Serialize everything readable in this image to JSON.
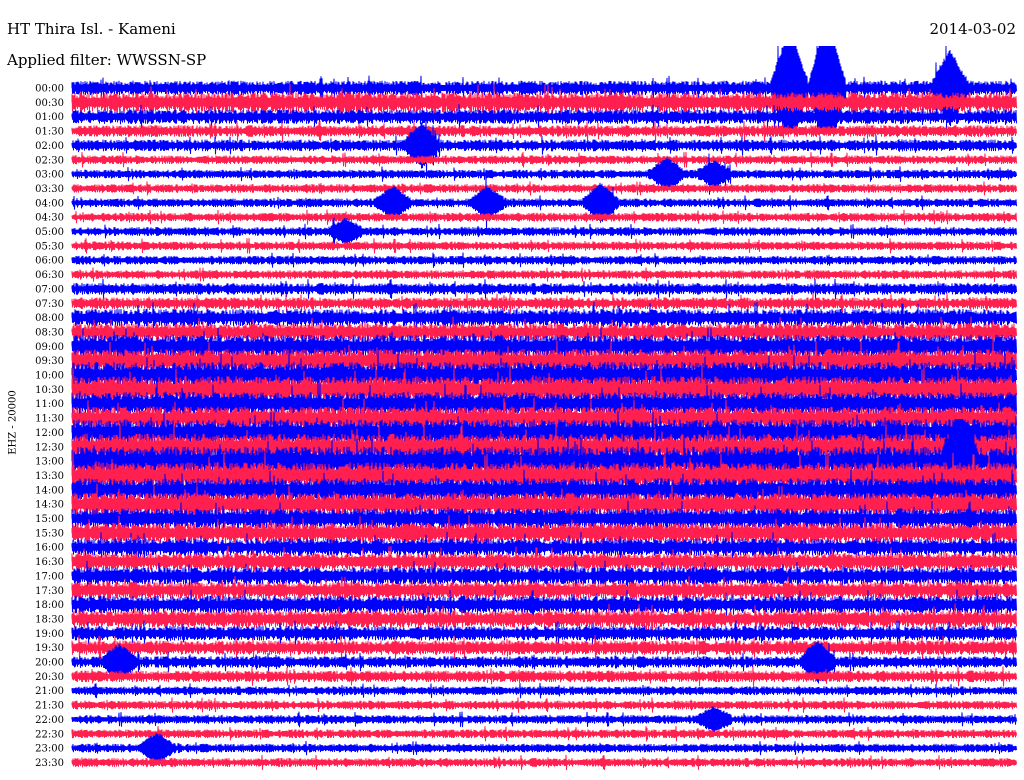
{
  "header": {
    "station": "HT Thira Isl. - Kameni",
    "filter": "Applied filter: WWSSN-SP",
    "date": "2014-03-02"
  },
  "channel_label": "EHZ - 20000",
  "colors": {
    "trace_a": "#0000ff",
    "trace_b": "#ff2050",
    "background": "#ffffff"
  },
  "chart_data": {
    "type": "line",
    "title": "HT Thira Isl. - Kameni",
    "subtitle": "Applied filter: WWSSN-SP",
    "ylabel": "EHZ - 20000",
    "grid": false,
    "row_labels": [
      "00:00",
      "00:30",
      "01:00",
      "01:30",
      "02:00",
      "02:30",
      "03:00",
      "03:30",
      "04:00",
      "04:30",
      "05:00",
      "05:30",
      "06:00",
      "06:30",
      "07:00",
      "07:30",
      "08:00",
      "08:30",
      "09:00",
      "09:30",
      "10:00",
      "10:30",
      "11:00",
      "11:30",
      "12:00",
      "12:30",
      "13:00",
      "13:30",
      "14:00",
      "14:30",
      "15:00",
      "15:30",
      "16:00",
      "16:30",
      "17:00",
      "17:30",
      "18:00",
      "18:30",
      "19:00",
      "19:30",
      "20:00",
      "20:30",
      "21:00",
      "21:30",
      "22:00",
      "22:30",
      "23:00",
      "23:30"
    ],
    "row_colors": [
      "blue",
      "red"
    ],
    "noise_level": [
      5,
      7,
      5,
      4,
      4,
      3,
      3,
      3,
      3,
      3,
      3,
      3,
      3,
      3,
      4,
      4,
      6,
      6,
      8,
      8,
      9,
      9,
      8,
      8,
      9,
      9,
      10,
      9,
      8,
      8,
      7,
      7,
      6,
      6,
      6,
      6,
      6,
      6,
      5,
      5,
      4,
      4,
      3,
      3,
      3,
      3,
      3,
      3
    ],
    "events": [
      {
        "row": 0,
        "x": [
          0.76,
          0.8,
          0.93
        ],
        "amp": [
          5,
          6,
          3
        ]
      },
      {
        "row": 4,
        "x": [
          0.37
        ],
        "amp": [
          2
        ]
      },
      {
        "row": 6,
        "x": [
          0.63,
          0.68
        ],
        "amp": [
          2,
          1.5
        ]
      },
      {
        "row": 8,
        "x": [
          0.34,
          0.44,
          0.56
        ],
        "amp": [
          2,
          2,
          2.5
        ]
      },
      {
        "row": 10,
        "x": [
          0.29
        ],
        "amp": [
          1.5
        ]
      },
      {
        "row": 26,
        "x": [
          0.94
        ],
        "amp": [
          1.8
        ]
      },
      {
        "row": 40,
        "x": [
          0.05,
          0.79
        ],
        "amp": [
          1.5,
          2
        ]
      },
      {
        "row": 44,
        "x": [
          0.68
        ],
        "amp": [
          1.5
        ]
      },
      {
        "row": 46,
        "x": [
          0.09
        ],
        "amp": [
          1.8
        ]
      }
    ]
  }
}
